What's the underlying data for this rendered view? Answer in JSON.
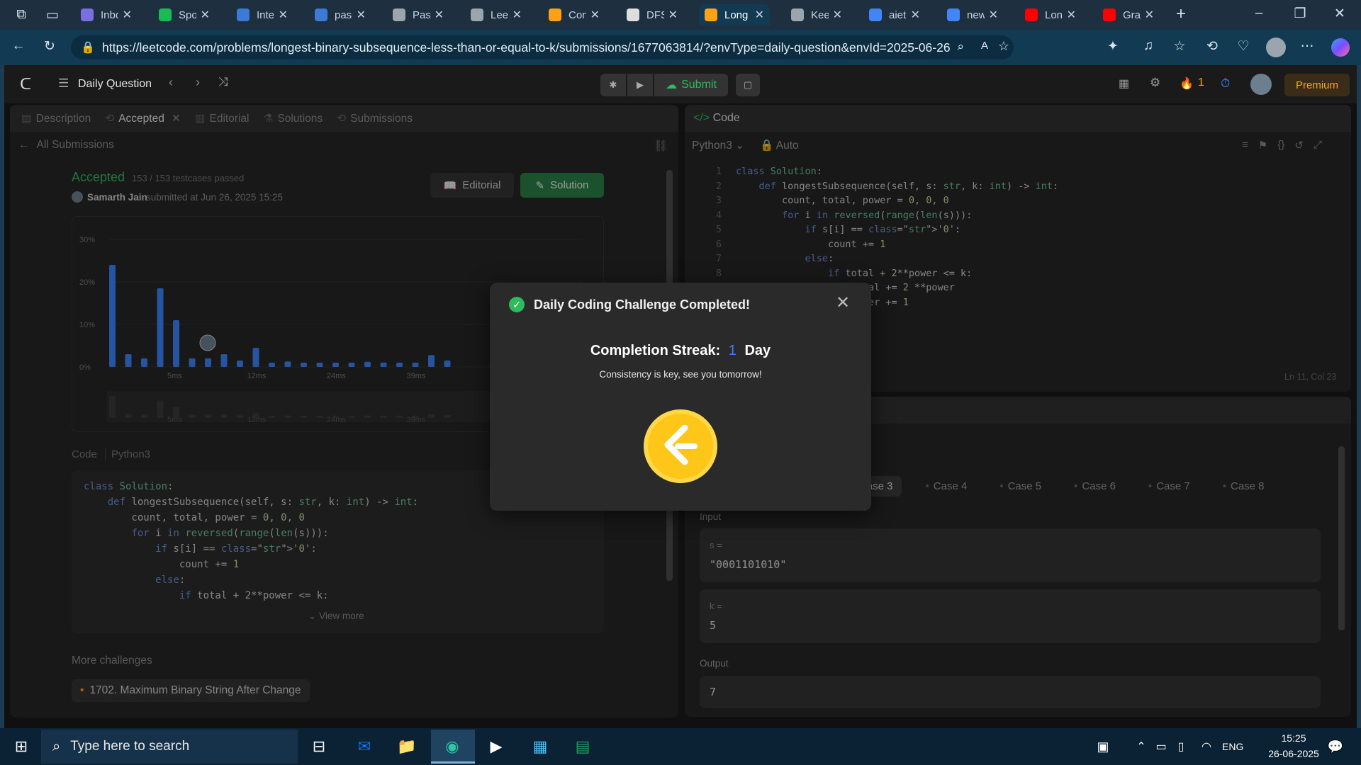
{
  "browser": {
    "tabs": [
      {
        "label": "Inbo",
        "color": "#7a6fe0"
      },
      {
        "label": "Spot",
        "color": "#1db954"
      },
      {
        "label": "Inter",
        "color": "#3b7bd5"
      },
      {
        "label": "pasc",
        "color": "#3b7bd5"
      },
      {
        "label": "Pasc",
        "color": "#9aa5ad"
      },
      {
        "label": "Leet",
        "color": "#9aa5ad"
      },
      {
        "label": "Cont",
        "color": "#ffa116"
      },
      {
        "label": "DFS",
        "color": "#dddddd"
      },
      {
        "label": "Long",
        "color": "#ffa116"
      },
      {
        "label": "Keep",
        "color": "#9aa5ad"
      },
      {
        "label": "aiet",
        "color": "#4285f4"
      },
      {
        "label": "new",
        "color": "#4285f4"
      },
      {
        "label": "Long",
        "color": "#ff0000"
      },
      {
        "label": "Grap",
        "color": "#ff0000"
      }
    ],
    "url": "https://leetcode.com/problems/longest-binary-subsequence-less-than-or-equal-to-k/submissions/1677063814/?envType=daily-question&envId=2025-06-26"
  },
  "lc": {
    "daily_label": "Daily Question",
    "submit_label": "Submit",
    "streak_count": "1",
    "premium_label": "Premium",
    "tabs": [
      "Description",
      "Accepted",
      "Editorial",
      "Solutions",
      "Submissions"
    ],
    "all_submissions": "All Submissions",
    "status": "Accepted",
    "testcases": "153 / 153 testcases passed",
    "user": "Samarth Jain",
    "submitted_text": "submitted at Jun 26, 2025 15:25",
    "editorial_btn": "Editorial",
    "solution_btn": "Solution",
    "code_label": "Code",
    "lang_label": "Python3",
    "view_more": "View more",
    "more_challenges": "More challenges",
    "challenge": "1702. Maximum Binary String After Change"
  },
  "chart_data": {
    "type": "bar",
    "ylabel": "",
    "yticks": [
      "30%",
      "20%",
      "10%",
      "0%"
    ],
    "xticks": [
      "5ms",
      "12ms",
      "24ms",
      "39ms"
    ],
    "values": [
      24,
      3,
      2,
      18.5,
      11,
      2,
      2,
      3,
      1.5,
      4.5,
      1,
      1.3,
      1,
      1,
      1,
      1,
      1.2,
      1,
      1,
      1,
      2.8,
      1.5
    ],
    "ylim": [
      0,
      30
    ]
  },
  "editor": {
    "title": "Code",
    "lang": "Python3",
    "mode": "Auto",
    "status": "Ln 11, Col 23",
    "lines": [
      "class Solution:",
      "    def longestSubsequence(self, s: str, k: int) -> int:",
      "        count, total, power = 0, 0, 0",
      "        for i in reversed(range(len(s))):",
      "            if s[i] == '0':",
      "                count += 1",
      "            else:",
      "                if total + 2**power <= k:",
      "                    total += 2 **power",
      "                    power += 1"
    ]
  },
  "submission_code": [
    "class Solution:",
    "    def longestSubsequence(self, s: str, k: int) -> int:",
    "        count, total, power = 0, 0, 0",
    "        for i in reversed(range(len(s))):",
    "            if s[i] == '0':",
    "                count += 1",
    "            else:",
    "                if total + 2**power <= k:"
  ],
  "testcase": {
    "cases": [
      "Case 3",
      "Case 4",
      "Case 5",
      "Case 6",
      "Case 7",
      "Case 8"
    ],
    "input_label": "Input",
    "s_label": "s =",
    "s_value": "\"0001101010\"",
    "k_label": "k =",
    "k_value": "5",
    "output_label": "Output",
    "output_value": "7"
  },
  "modal": {
    "title": "Daily Coding Challenge Completed!",
    "streak_label": "Completion Streak:",
    "streak_value": "1",
    "streak_unit": "Day",
    "subtitle": "Consistency is key, see you tomorrow!"
  },
  "taskbar": {
    "search_placeholder": "Type here to search",
    "lang": "ENG",
    "time": "15:25",
    "date": "26-06-2025"
  }
}
